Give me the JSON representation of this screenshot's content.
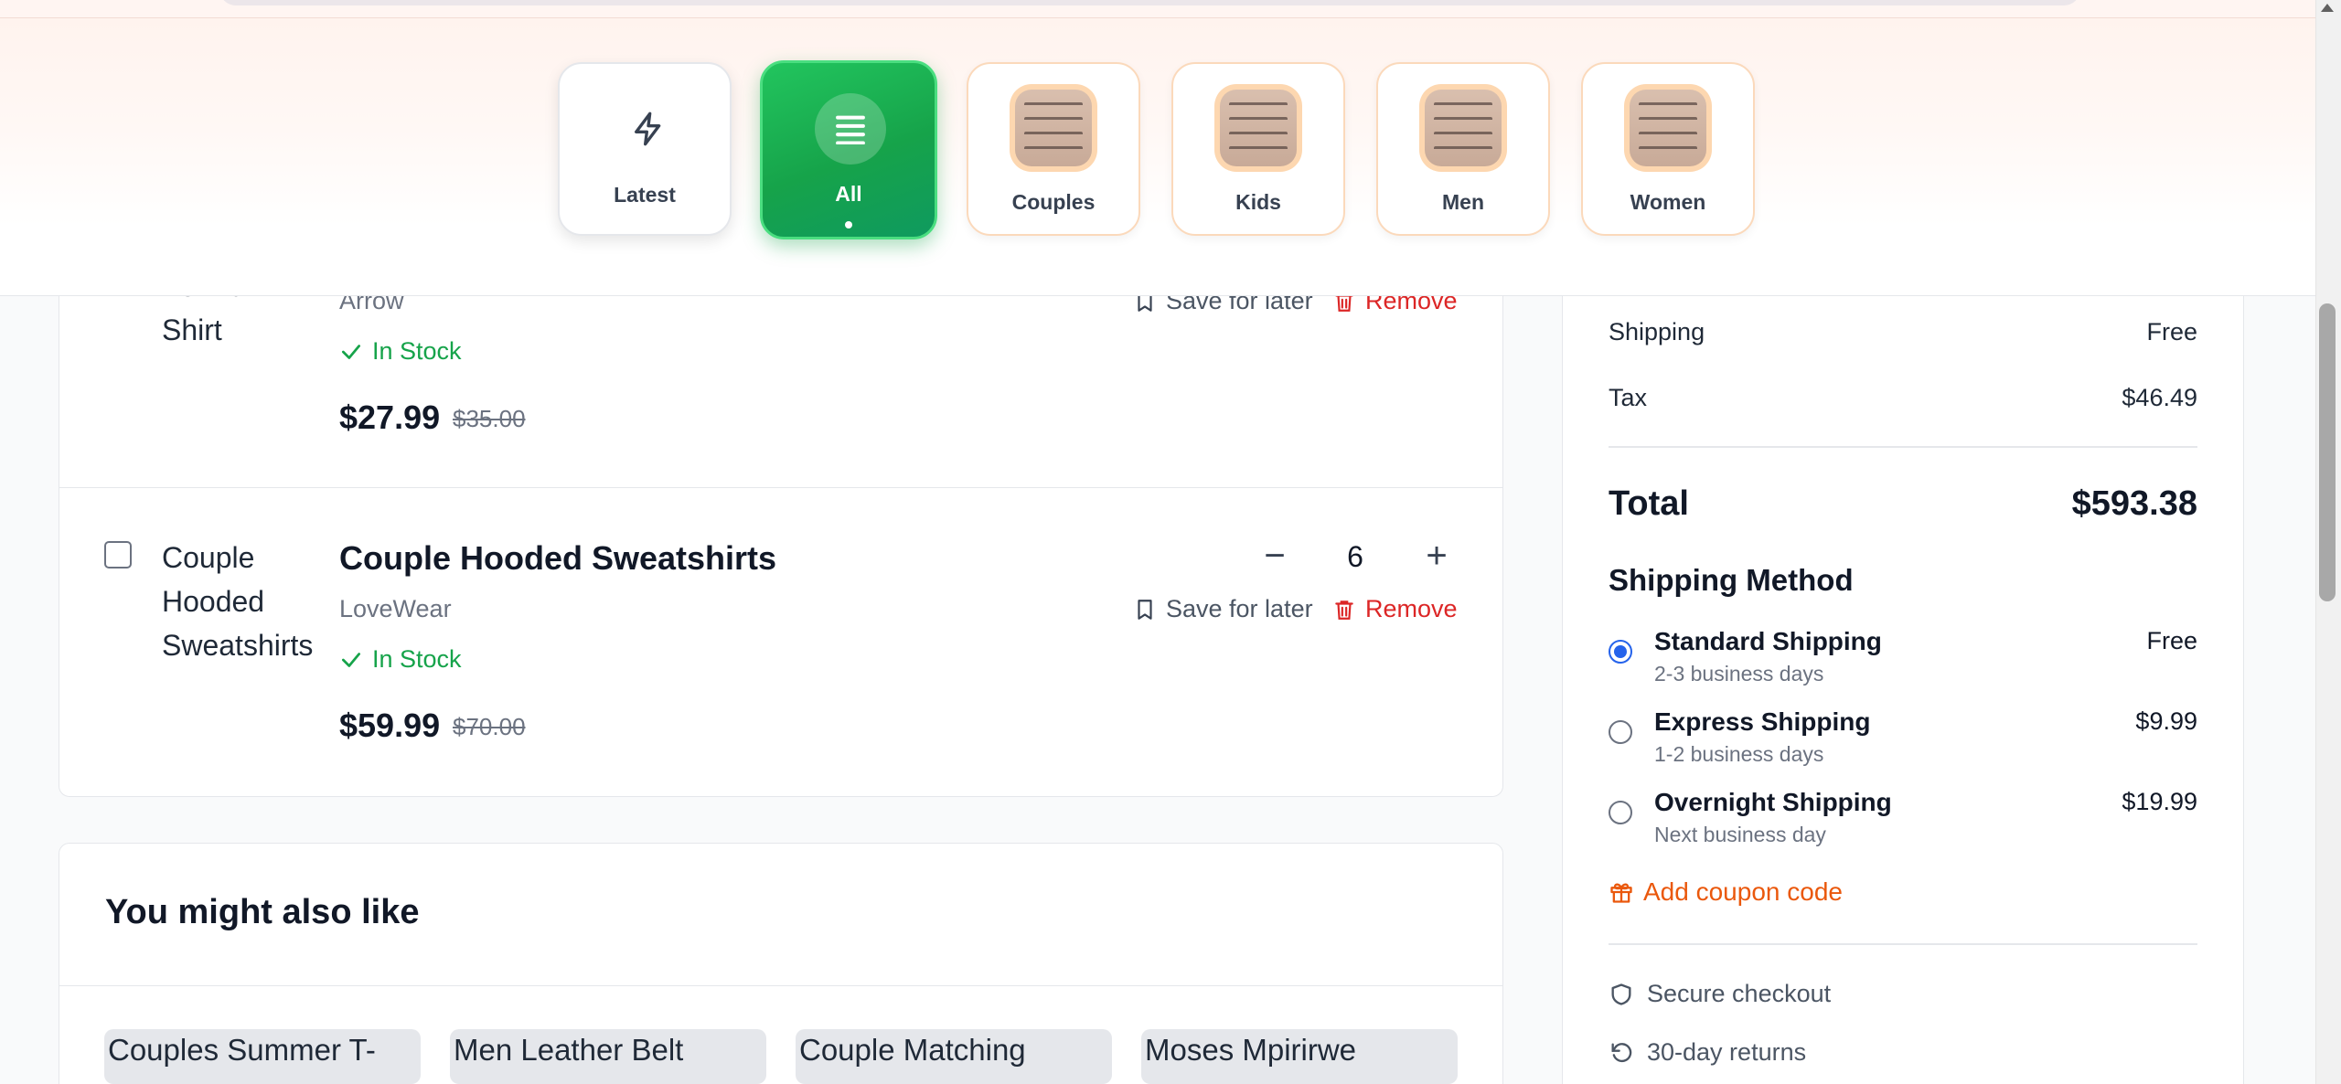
{
  "categories": [
    {
      "label": "Latest",
      "icon": "lightning-icon"
    },
    {
      "label": "All",
      "icon": "list-icon",
      "active": true
    },
    {
      "label": "Couples",
      "icon": "category-thumbnail"
    },
    {
      "label": "Kids",
      "icon": "category-thumbnail"
    },
    {
      "label": "Men",
      "icon": "category-thumbnail"
    },
    {
      "label": "Women",
      "icon": "category-thumbnail"
    }
  ],
  "cart": {
    "items": [
      {
        "image_alt_partial": "Formal",
        "image_alt_line2": "Shirt",
        "brand": "Arrow",
        "stock": "In Stock",
        "price": "$27.99",
        "old_price": "$35.00",
        "save_label": "Save for later",
        "remove_label": "Remove"
      },
      {
        "image_alt": "Couple Hooded Sweatshirts",
        "image_alt_lines": [
          "Couple",
          "Hooded",
          "Sweatshirts"
        ],
        "title": "Couple Hooded Sweatshirts",
        "brand": "LoveWear",
        "stock": "In Stock",
        "price": "$59.99",
        "old_price": "$70.00",
        "quantity": "6",
        "minus": "−",
        "plus": "+",
        "save_label": "Save for later",
        "remove_label": "Remove"
      }
    ]
  },
  "recommendations": {
    "title": "You might also like",
    "items": [
      {
        "image_alt": "Couples Summer T-"
      },
      {
        "image_alt": "Men Leather Belt"
      },
      {
        "image_alt": "Couple Matching"
      },
      {
        "image_alt": "Moses Mpirirwe"
      }
    ]
  },
  "summary": {
    "shipping_label": "Shipping",
    "shipping_value": "Free",
    "tax_label": "Tax",
    "tax_value": "$46.49",
    "total_label": "Total",
    "total_value": "$593.38",
    "shipping_method_title": "Shipping Method",
    "shipping_options": [
      {
        "name": "Standard Shipping",
        "desc": "2-3 business days",
        "price": "Free",
        "selected": true
      },
      {
        "name": "Express Shipping",
        "desc": "1-2 business days",
        "price": "$9.99",
        "selected": false
      },
      {
        "name": "Overnight Shipping",
        "desc": "Next business day",
        "price": "$19.99",
        "selected": false
      }
    ],
    "coupon_label": "Add coupon code",
    "trust": [
      {
        "label": "Secure checkout",
        "icon": "shield-icon"
      },
      {
        "label": "30-day returns",
        "icon": "rotate-ccw-icon"
      }
    ]
  },
  "colors": {
    "accent_green": "#16a34a",
    "remove_red": "#dc2626",
    "coupon_orange": "#ea580c",
    "radio_blue": "#2563eb"
  }
}
